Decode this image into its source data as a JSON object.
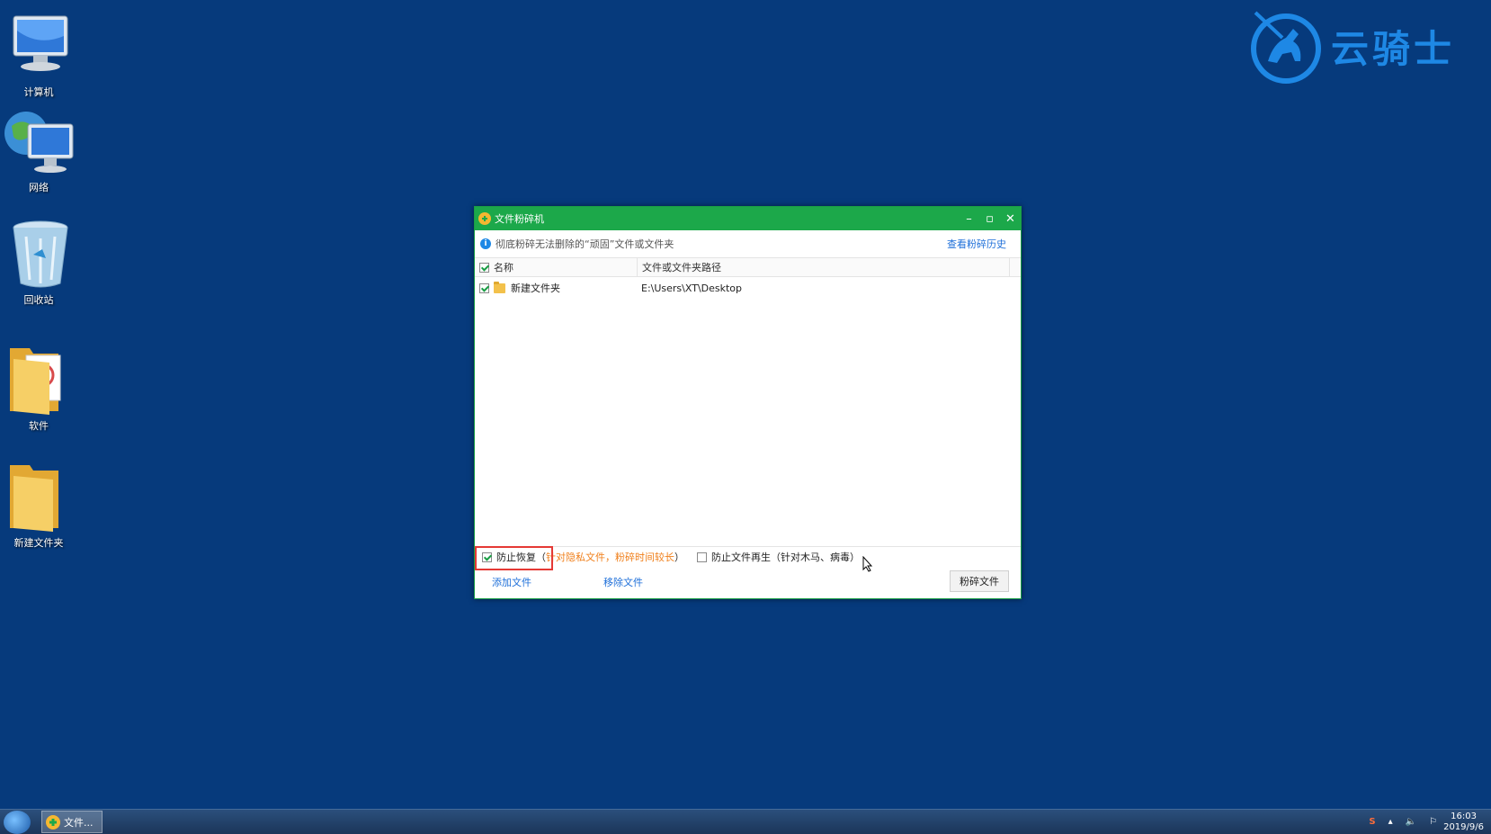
{
  "desktop": {
    "icons": [
      {
        "label": "计算机",
        "icon": "computer-icon"
      },
      {
        "label": "网络",
        "icon": "network-icon"
      },
      {
        "label": "回收站",
        "icon": "recycle-bin-icon"
      },
      {
        "label": "软件",
        "icon": "folder-icon"
      },
      {
        "label": "新建文件夹",
        "icon": "folder-icon"
      }
    ],
    "brand": {
      "text": "云骑士",
      "color": "#1e88e5"
    }
  },
  "window": {
    "title": "文件粉碎机",
    "info_message": "彻底粉碎无法删除的“顽固”文件或文件夹",
    "history_link": "查看粉碎历史",
    "columns": {
      "name": "名称",
      "path": "文件或文件夹路径"
    },
    "rows": [
      {
        "checked": true,
        "name": "新建文件夹",
        "path": "E:\\Users\\XT\\Desktop"
      }
    ],
    "options": {
      "prevent_recovery": {
        "label": "防止恢复（",
        "note": "针对隐私文件，粉碎时间较长",
        "close": "）",
        "checked": true
      },
      "prevent_regen": {
        "label": "防止文件再生（针对木马、病毒）",
        "checked": false
      }
    },
    "actions": {
      "add": "添加文件",
      "remove": "移除文件",
      "shred": "粉碎文件"
    },
    "accent_color": "#1ca84a"
  },
  "taskbar": {
    "item_label": "文件...",
    "clock_time": "16:03",
    "clock_date": "2019/9/6"
  }
}
